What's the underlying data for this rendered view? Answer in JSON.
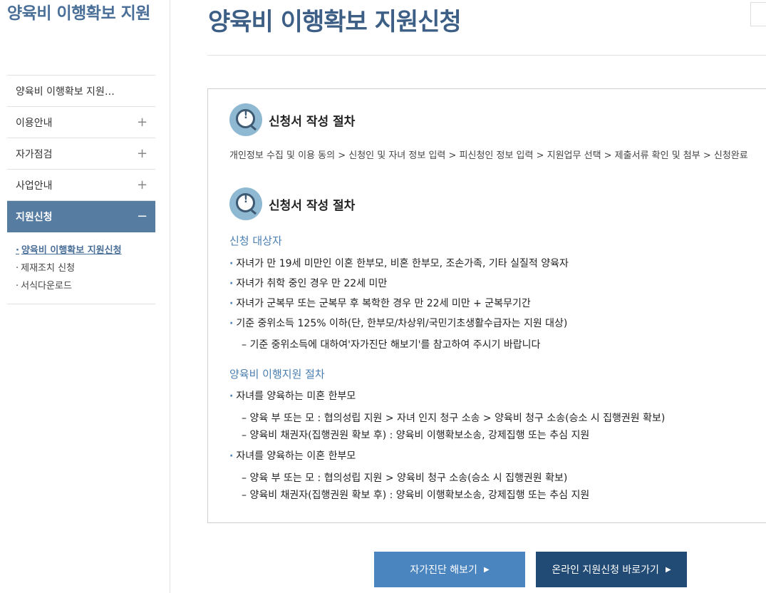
{
  "sidebar": {
    "title": "양육비 이행확보 지원",
    "menu": [
      {
        "label": "양육비 이행확보 지원…",
        "toggle": ""
      },
      {
        "label": "이용안내",
        "toggle": "+"
      },
      {
        "label": "자가점검",
        "toggle": "+"
      },
      {
        "label": "사업안내",
        "toggle": "+"
      },
      {
        "label": "지원신청",
        "toggle": "−"
      }
    ],
    "submenu": [
      {
        "label": "양육비 이행확보 지원신청",
        "dot": "·"
      },
      {
        "label": "제재조치 신청",
        "dot": "·"
      },
      {
        "label": "서식다운로드",
        "dot": "·"
      }
    ]
  },
  "page": {
    "title": "양육비 이행확보 지원신청"
  },
  "content": {
    "section1": {
      "heading": "신청서 작성 절차",
      "icon_mark": "!",
      "steps": "개인정보 수집 및 이용 동의 > 신청인 및 자녀 정보 입력 > 피신청인 정보 입력 > 지원업무 선택 > 제출서류 확인 및 첨부 > 신청완료"
    },
    "section2": {
      "heading": "신청서 작성 절차",
      "icon_mark": "!",
      "eligibility_title": "신청 대상자",
      "eligibility": [
        "자녀가 만 19세 미만인 이혼 한부모, 비혼 한부모, 조손가족, 기타 실질적 양육자",
        "자녀가 취학 중인 경우 만 22세 미만",
        "자녀가 군복무 또는 군복무 후 복학한 경우 만 22세 미만 + 군복무기간",
        "기준 중위소득 125% 이하(단, 한부모/차상위/국민기초생활수급자는 지원 대상)"
      ],
      "eligibility_note": "– 기준 중위소득에 대하여'자가진단 해보기'를 참고하여 주시기 바랍니다",
      "procedure_title": "양육비 이행지원 절차",
      "group1_title": "자녀를 양육하는 미혼 한부모",
      "group1_items": [
        "– 양육 부 또는 모 : 협의성립 지원 > 자녀 인지 청구 소송 > 양육비 청구 소송(승소 시 집행권원 확보)",
        "– 양육비 채권자(집행권원 확보 후) : 양육비 이행확보소송, 강제집행 또는 추심 지원"
      ],
      "group2_title": "자녀를 양육하는 이혼 한부모",
      "group2_items": [
        "– 양육 부 또는 모 : 협의성립 지원 > 양육비 청구 소송(승소 시 집행권원 확보)",
        "– 양육비 채권자(집행권원 확보 후) : 양육비 이행확보소송, 강제집행 또는 추심 지원"
      ],
      "bullet_dot": "·"
    }
  },
  "buttons": {
    "diagnosis": "자가진단 해보기",
    "online": "온라인 지원신청 바로가기",
    "arrow": "▶"
  },
  "colors": {
    "accent": "#4a6f98",
    "active_menu": "#567ca1",
    "button_light": "#4a85bf",
    "button_dark": "#214a74"
  }
}
